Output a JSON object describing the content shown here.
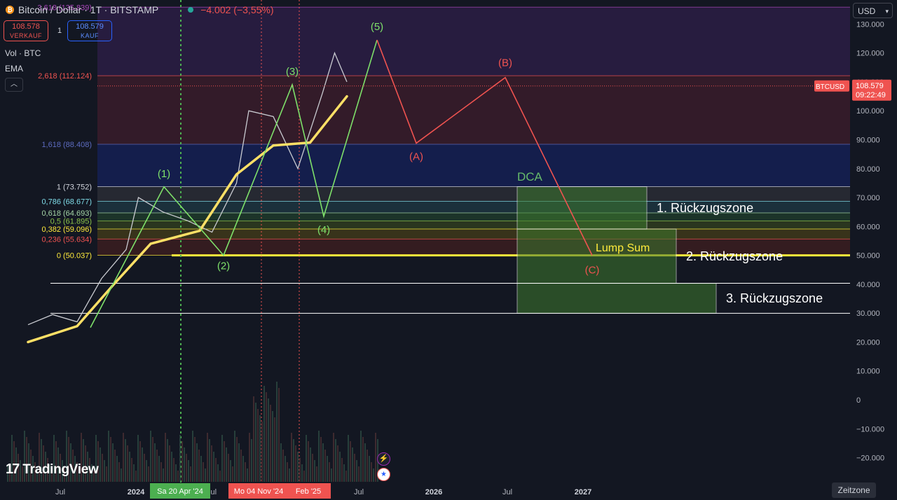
{
  "header": {
    "symbol_title": "Bitcoin / Dollar · 1T · BITSTAMP",
    "change": "−4.002 (−3,55%)",
    "sell_price": "108.578",
    "sell_label": "VERKAUF",
    "spread": "1",
    "buy_price": "108.579",
    "buy_label": "KAUF",
    "indicator_vol": "Vol · BTC",
    "indicator_ema": "EMA",
    "currency": "USD"
  },
  "branding": {
    "logo_text": "TradingView",
    "timezone_button": "Zeitzone"
  },
  "chart_data": {
    "type": "line",
    "title": "Bitcoin / Dollar · 1T · BITSTAMP",
    "y_axis_ticks": [
      130000,
      120000,
      110000,
      100000,
      90000,
      80000,
      70000,
      60000,
      50000,
      40000,
      30000,
      20000,
      10000,
      0,
      -10000,
      -20000
    ],
    "y_tick_labels": [
      "130.000",
      "120.000",
      "110.000",
      "100.000",
      "90.000",
      "80.000",
      "70.000",
      "60.000",
      "50.000",
      "40.000",
      "30.000",
      "20.000",
      "10.000",
      "0",
      "−10.000",
      "−20.000"
    ],
    "x_axis_labels": [
      "Jul",
      "2024",
      "Jul",
      "2025",
      "Jul",
      "2026",
      "Jul",
      "2027"
    ],
    "date_markers": [
      "Sa 20 Apr '24",
      "Mo 04 Nov '24",
      "Feb '25"
    ],
    "fibonacci_levels": [
      {
        "label": "0 (50.037)",
        "value": 50037,
        "color": "#ffeb3b"
      },
      {
        "label": "0,236 (55.634)",
        "value": 55634,
        "color": "#ef5350"
      },
      {
        "label": "0,382 (59.096)",
        "value": 59096,
        "color": "#ffeb3b"
      },
      {
        "label": "0,5 (61.895)",
        "value": 61895,
        "color": "#8bc34a"
      },
      {
        "label": "0,618 (64.693)",
        "value": 64693,
        "color": "#a5d6a7"
      },
      {
        "label": "0,786 (68.677)",
        "value": 68677,
        "color": "#80deea"
      },
      {
        "label": "1 (73.752)",
        "value": 73752,
        "color": "#d1d4dc"
      },
      {
        "label": "1,618 (88.408)",
        "value": 88408,
        "color": "#5c6bc0"
      },
      {
        "label": "2,618 (112.124)",
        "value": 112124,
        "color": "#ef5350"
      },
      {
        "label": "3,618 (135.839)",
        "value": 135839,
        "color": "#ab47bc"
      }
    ],
    "horizontal_levels": [
      {
        "label": "50.002",
        "value": 50002,
        "color": "#ffeb3b"
      },
      {
        "label": "40.326",
        "value": 40326,
        "color": "#ffffff"
      },
      {
        "label": "29.962",
        "value": 29962,
        "color": "#ffffff"
      }
    ],
    "last_price": {
      "symbol": "BTCUSD",
      "value": "108.579",
      "countdown": "09:22:49",
      "numeric": 108579
    },
    "impulse_wave": {
      "labels": [
        "(1)",
        "(2)",
        "(3)",
        "(4)",
        "(5)"
      ],
      "values": [
        73700,
        50000,
        109000,
        63500,
        124500
      ]
    },
    "corrective_wave": {
      "labels": [
        "(A)",
        "(B)",
        "(C)"
      ],
      "values": [
        88800,
        111500,
        50000
      ]
    },
    "zones": [
      {
        "label": "DCA",
        "kind": "title"
      },
      {
        "label": "1. Rückzugszone",
        "top": 73752,
        "bottom": 59096
      },
      {
        "label": "2. Rückzugszone",
        "top": 59096,
        "bottom": 40326
      },
      {
        "label": "3. Rückzugszone",
        "top": 40326,
        "bottom": 29962
      },
      {
        "label": "Lump Sum",
        "kind": "title"
      }
    ],
    "series": [
      {
        "name": "",
        "type": "price",
        "x": [
          "2023-06",
          "2023-08",
          "2023-10",
          "2023-12",
          "2024-02",
          "2024-03",
          "2024-05",
          "2024-07",
          "2024-09",
          "2024-11",
          "2024-12",
          "2025-02",
          "2025-04",
          "2025-06",
          "2025-07",
          "2025-08"
        ],
        "values": [
          26000,
          29500,
          27000,
          42000,
          52000,
          70000,
          65000,
          62000,
          58000,
          75000,
          100000,
          98000,
          80000,
          106000,
          120000,
          110000
        ]
      },
      {
        "name": "EMA",
        "type": "ema",
        "x": [
          "2023-06",
          "2023-10",
          "2024-01",
          "2024-04",
          "2024-08",
          "2024-11",
          "2025-02",
          "2025-05",
          "2025-08"
        ],
        "values": [
          20000,
          25500,
          40000,
          54000,
          58500,
          78000,
          88000,
          89000,
          105000
        ]
      }
    ]
  }
}
